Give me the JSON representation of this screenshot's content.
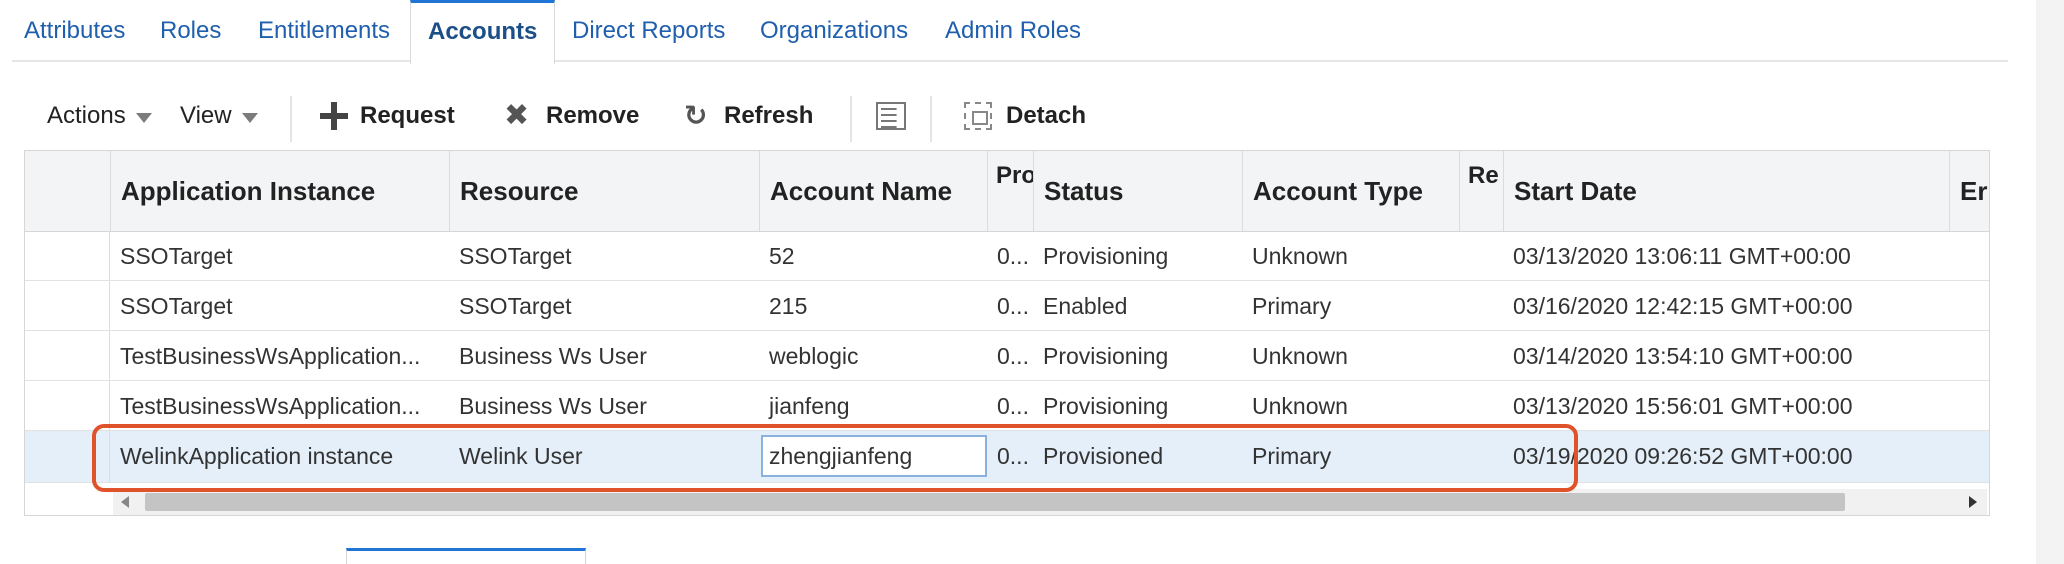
{
  "tabs": [
    {
      "label": "Attributes"
    },
    {
      "label": "Roles"
    },
    {
      "label": "Entitlements"
    },
    {
      "label": "Accounts",
      "active": true
    },
    {
      "label": "Direct Reports"
    },
    {
      "label": "Organizations"
    },
    {
      "label": "Admin Roles"
    }
  ],
  "toolbar": {
    "actions_label": "Actions",
    "view_label": "View",
    "request_label": "Request",
    "remove_label": "Remove",
    "refresh_label": "Refresh",
    "detach_label": "Detach"
  },
  "table": {
    "columns": {
      "application_instance": "Application Instance",
      "resource": "Resource",
      "account_name": "Account Name",
      "provisioned_on": "Pro On",
      "status": "Status",
      "account_type": "Account Type",
      "request_id": "Re ID",
      "start_date": "Start Date",
      "end_date": "Er"
    },
    "rows": [
      {
        "application_instance": "SSOTarget",
        "resource": "SSOTarget",
        "account_name": "52",
        "provisioned_on": "0...",
        "status": "Provisioning",
        "account_type": "Unknown",
        "start_date": "03/13/2020 13:06:11 GMT+00:00"
      },
      {
        "application_instance": "SSOTarget",
        "resource": "SSOTarget",
        "account_name": "215",
        "provisioned_on": "0...",
        "status": "Enabled",
        "account_type": "Primary",
        "start_date": "03/16/2020 12:42:15 GMT+00:00"
      },
      {
        "application_instance": "TestBusinessWsApplication...",
        "resource": "Business Ws User",
        "account_name": "weblogic",
        "provisioned_on": "0...",
        "status": "Provisioning",
        "account_type": "Unknown",
        "start_date": "03/14/2020 13:54:10 GMT+00:00"
      },
      {
        "application_instance": "TestBusinessWsApplication...",
        "resource": "Business Ws User",
        "account_name": "jianfeng",
        "provisioned_on": "0...",
        "status": "Provisioning",
        "account_type": "Unknown",
        "start_date": "03/13/2020 15:56:01 GMT+00:00"
      },
      {
        "application_instance": "WelinkApplication instance",
        "resource": "Welink User",
        "account_name": "zhengjianfeng",
        "provisioned_on": "0...",
        "status": "Provisioned",
        "account_type": "Primary",
        "start_date": "03/19/2020 09:26:52 GMT+00:00",
        "selected": true
      }
    ]
  },
  "colors": {
    "accent": "#1f5fae",
    "highlight": "#e0532a",
    "selected_row": "#e4eff9",
    "header_bg": "#f2f4f5"
  }
}
